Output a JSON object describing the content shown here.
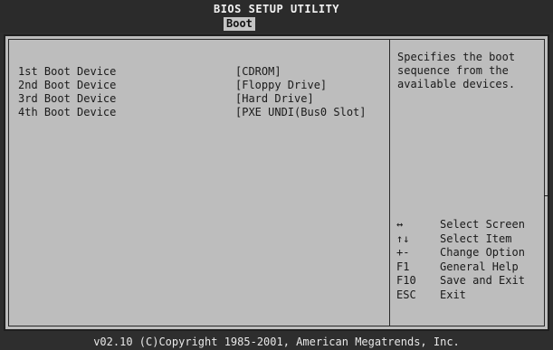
{
  "header": {
    "title": "BIOS SETUP UTILITY",
    "active_tab": "Boot"
  },
  "boot_devices": [
    {
      "label": "1st Boot Device",
      "value": "[CDROM]"
    },
    {
      "label": "2nd Boot Device",
      "value": "[Floppy Drive]"
    },
    {
      "label": "3rd Boot Device",
      "value": "[Hard Drive]"
    },
    {
      "label": "4th Boot Device",
      "value": "[PXE UNDI(Bus0 Slot]"
    }
  ],
  "help": {
    "text": "Specifies the boot sequence from the available devices."
  },
  "keys": [
    {
      "key": "↔",
      "desc": "Select Screen",
      "icon": "left-right-arrow-icon"
    },
    {
      "key": "↑↓",
      "desc": "Select Item",
      "icon": "up-down-arrow-icon"
    },
    {
      "key": "+-",
      "desc": "Change Option",
      "icon": "plus-minus-icon"
    },
    {
      "key": "F1",
      "desc": "General Help"
    },
    {
      "key": "F10",
      "desc": "Save and Exit"
    },
    {
      "key": "ESC",
      "desc": "Exit"
    }
  ],
  "footer": {
    "copyright": "v02.10 (C)Copyright 1985-2001, American Megatrends, Inc."
  }
}
